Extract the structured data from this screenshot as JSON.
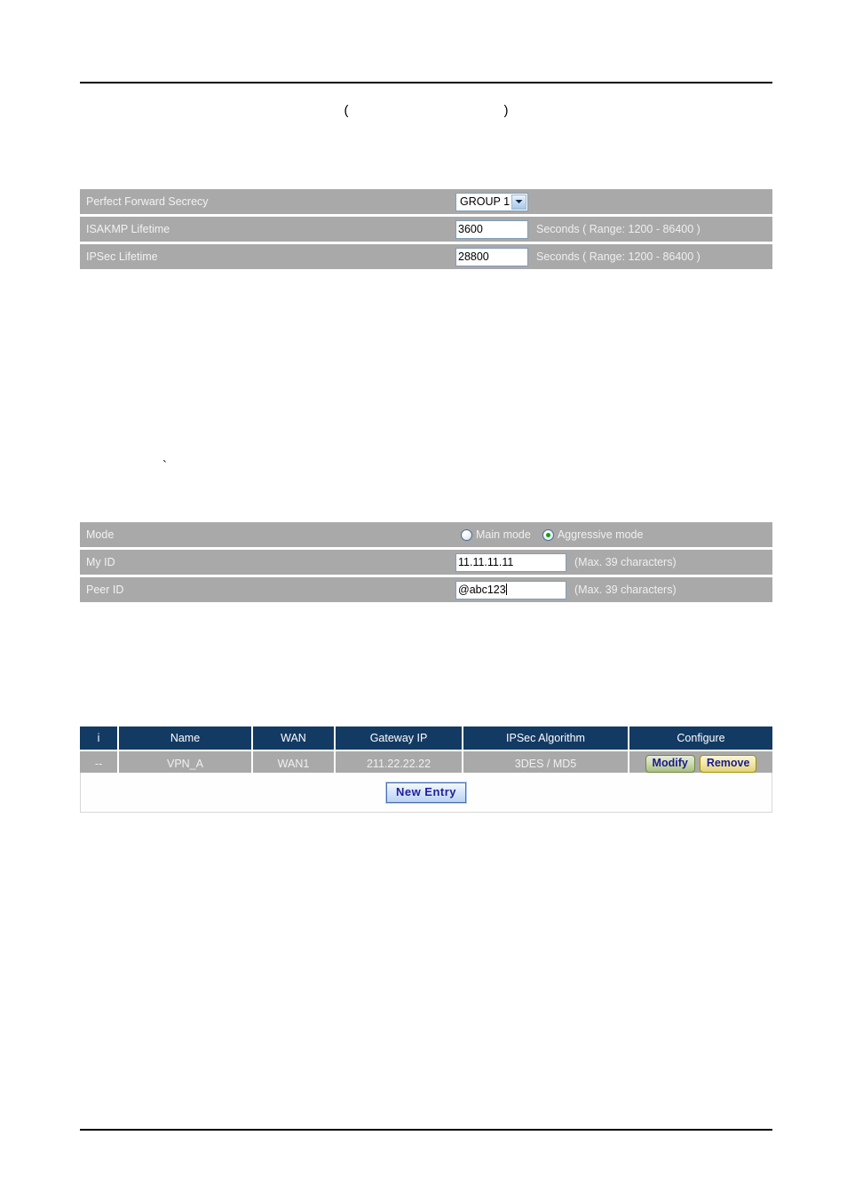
{
  "header": {
    "paren_open": "(",
    "paren_close": ")"
  },
  "stray_mark": "`",
  "ike_table": {
    "rows": [
      {
        "label": "Perfect Forward Secrecy",
        "control": "select",
        "value": "GROUP 1",
        "hint": ""
      },
      {
        "label": "ISAKMP Lifetime",
        "control": "input",
        "value": "3600",
        "hint": "Seconds  ( Range: 1200 - 86400 )"
      },
      {
        "label": "IPSec Lifetime",
        "control": "input",
        "value": "28800",
        "hint": "Seconds  ( Range: 1200 - 86400 )"
      }
    ]
  },
  "id_table": {
    "rows": [
      {
        "label": "Mode",
        "control": "radio",
        "options": [
          {
            "label": "Main mode",
            "checked": false
          },
          {
            "label": "Aggressive mode",
            "checked": true
          }
        ]
      },
      {
        "label": "My ID",
        "control": "input",
        "value": "11.11.11.11",
        "hint": "(Max. 39 characters)"
      },
      {
        "label": "Peer ID",
        "control": "input",
        "value": "@abc123",
        "hint": "(Max. 39 characters)",
        "focused": true
      }
    ]
  },
  "entry_list": {
    "columns": [
      "i",
      "Name",
      "WAN",
      "Gateway IP",
      "IPSec Algorithm",
      "Configure"
    ],
    "rows": [
      {
        "index": "--",
        "name": "VPN_A",
        "wan": "WAN1",
        "gateway_ip": "211.22.22.22",
        "algorithm": "3DES / MD5",
        "modify_label": "Modify",
        "remove_label": "Remove"
      }
    ],
    "new_entry_label": "New  Entry"
  },
  "colors": {
    "row_gray": "#a9a9a9",
    "header_navy": "#133a63",
    "input_border": "#7f9db9",
    "radio_checked": "#1a9c1a",
    "button_text": "#1a1a8c"
  }
}
